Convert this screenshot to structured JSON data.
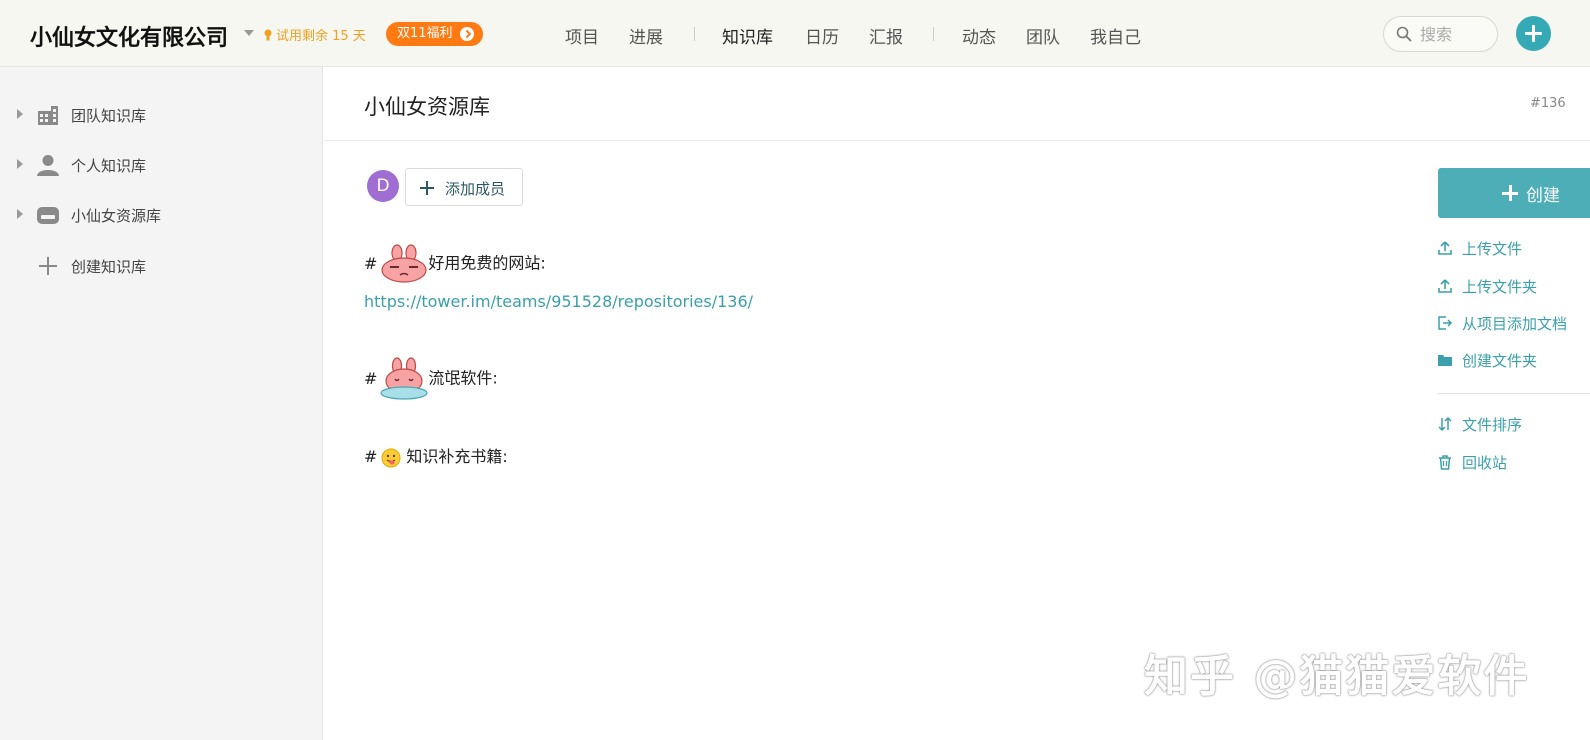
{
  "header": {
    "team_name": "小仙女文化有限公司",
    "trial_text": "试用剩余 15 天",
    "promo_label": "双11福利",
    "nav": [
      "项目",
      "进展",
      "知识库",
      "日历",
      "汇报",
      "动态",
      "团队",
      "我自己"
    ],
    "active_nav": "知识库",
    "search_placeholder": "搜索",
    "accent_color": "#35a9b5"
  },
  "sidebar": {
    "items": [
      {
        "label": "团队知识库",
        "icon": "building-icon"
      },
      {
        "label": "个人知识库",
        "icon": "person-icon"
      },
      {
        "label": "小仙女资源库",
        "icon": "drive-icon"
      },
      {
        "label": "创建知识库",
        "icon": "plus-icon"
      }
    ]
  },
  "main": {
    "title": "小仙女资源库",
    "repo_id": "#136",
    "avatar_letter": "D",
    "add_member_label": "添加成员",
    "notes": [
      {
        "hash": "#",
        "text": "好用免费的网站:",
        "sticker": "rabbit-squint-sticker"
      },
      {
        "link": "https://tower.im/teams/951528/repositories/136/"
      },
      {
        "hash": "#",
        "text": "流氓软件:",
        "sticker": "rabbit-melting-sticker"
      },
      {
        "hash": "#",
        "text": "知识补充书籍:",
        "sticker": "tongue-emoji"
      }
    ]
  },
  "actions": {
    "create_label": "创建",
    "items": [
      "上传文件",
      "上传文件夹",
      "从项目添加文档",
      "创建文件夹",
      "文件排序",
      "回收站"
    ]
  },
  "watermark": "知乎 @猫猫爱软件"
}
